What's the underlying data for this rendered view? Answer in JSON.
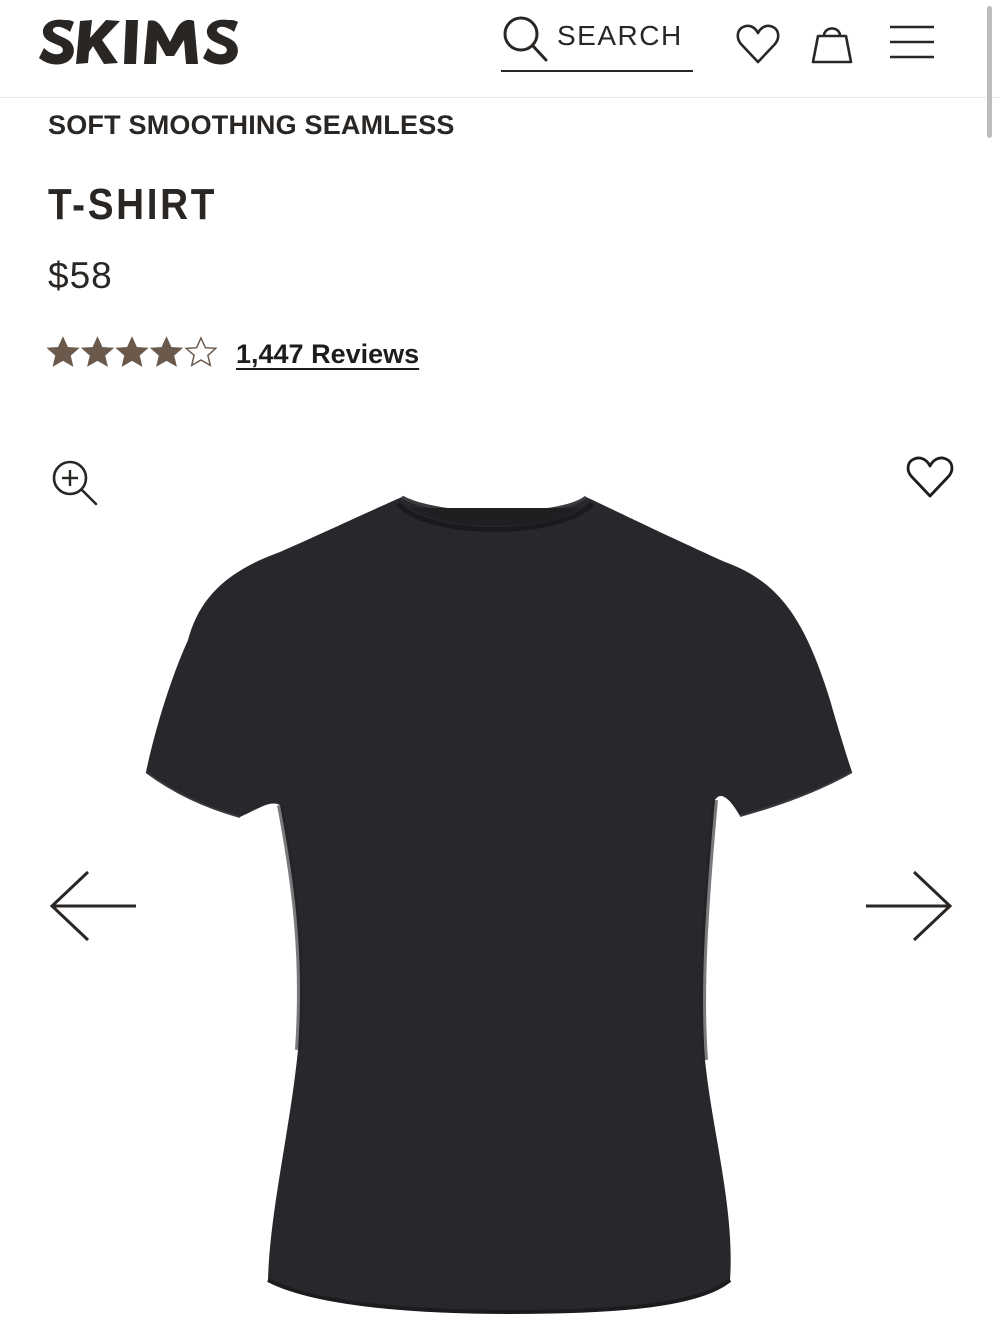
{
  "brand": {
    "logo_text": "SKIMS",
    "icon": "skims-logo"
  },
  "header": {
    "search_label": "SEARCH",
    "icons": [
      "search-icon",
      "heart-icon",
      "shopping-bag-icon",
      "hamburger-menu-icon"
    ]
  },
  "product": {
    "collection": "SOFT SMOOTHING SEAMLESS",
    "name": "T-SHIRT",
    "price": "$58",
    "rating": {
      "stars": 4.5,
      "max_stars": 5,
      "reviews_label": "1,447 Reviews"
    },
    "image": {
      "description_icon": "black-t-shirt-image"
    }
  },
  "gallery": {
    "icons": [
      "zoom-in-icon",
      "heart-icon",
      "arrow-left-icon",
      "arrow-right-icon"
    ]
  },
  "colors": {
    "text": "#2a2623",
    "star": "#6b5a4c",
    "garment": "#28282c",
    "background": "#ffffff"
  }
}
